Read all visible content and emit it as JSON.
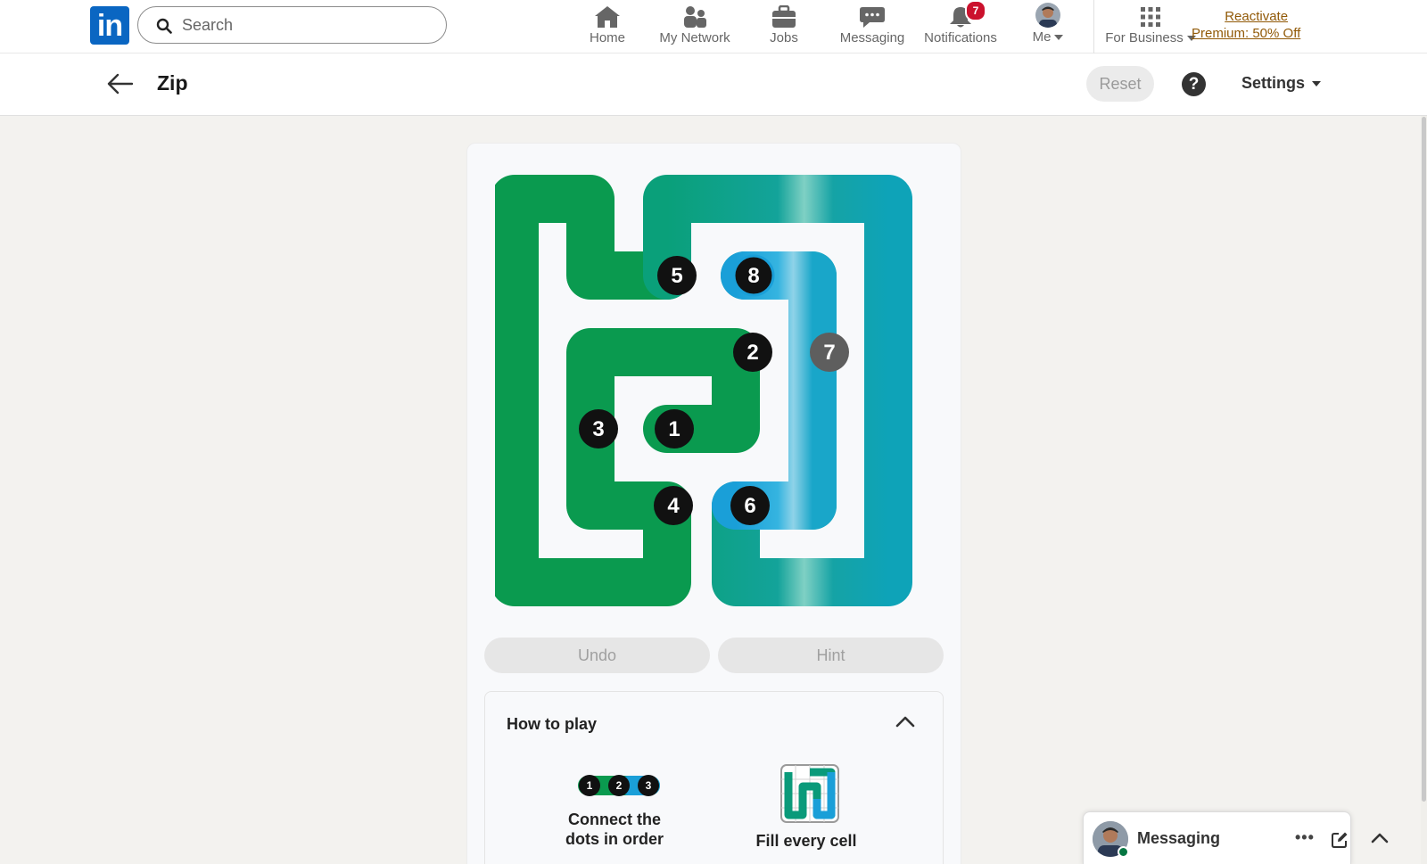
{
  "nav": {
    "logo_text": "in",
    "search_placeholder": "Search",
    "items": [
      {
        "label": "Home",
        "icon": "home-icon"
      },
      {
        "label": "My Network",
        "icon": "network-icon"
      },
      {
        "label": "Jobs",
        "icon": "briefcase-icon"
      },
      {
        "label": "Messaging",
        "icon": "chat-icon"
      },
      {
        "label": "Notifications",
        "icon": "bell-icon",
        "badge": "7"
      },
      {
        "label": "Me",
        "icon": "avatar"
      },
      {
        "label": "For Business",
        "icon": "grid-icon"
      }
    ],
    "premium_line1": "Reactivate",
    "premium_line2": "Premium: 50% Off"
  },
  "game": {
    "title": "Zip",
    "reset_label": "Reset",
    "help_label": "?",
    "settings_label": "Settings",
    "undo_label": "Undo",
    "hint_label": "Hint",
    "dots": [
      "1",
      "2",
      "3",
      "4",
      "5",
      "6",
      "7",
      "8"
    ]
  },
  "how_to_play": {
    "title": "How to play",
    "rule1_dots": [
      "1",
      "2",
      "3"
    ],
    "rule1_line1": "Connect the",
    "rule1_line2": "dots in order",
    "rule2": "Fill every cell"
  },
  "messaging_dock": {
    "label": "Messaging",
    "more": "•••"
  },
  "colors": {
    "brand": "#0a66c2",
    "path_green": "#0a9a4f",
    "path_teal": "#0d9a92",
    "path_blue": "#1aa3d6",
    "badge": "#cb112d",
    "premium": "#915907"
  }
}
